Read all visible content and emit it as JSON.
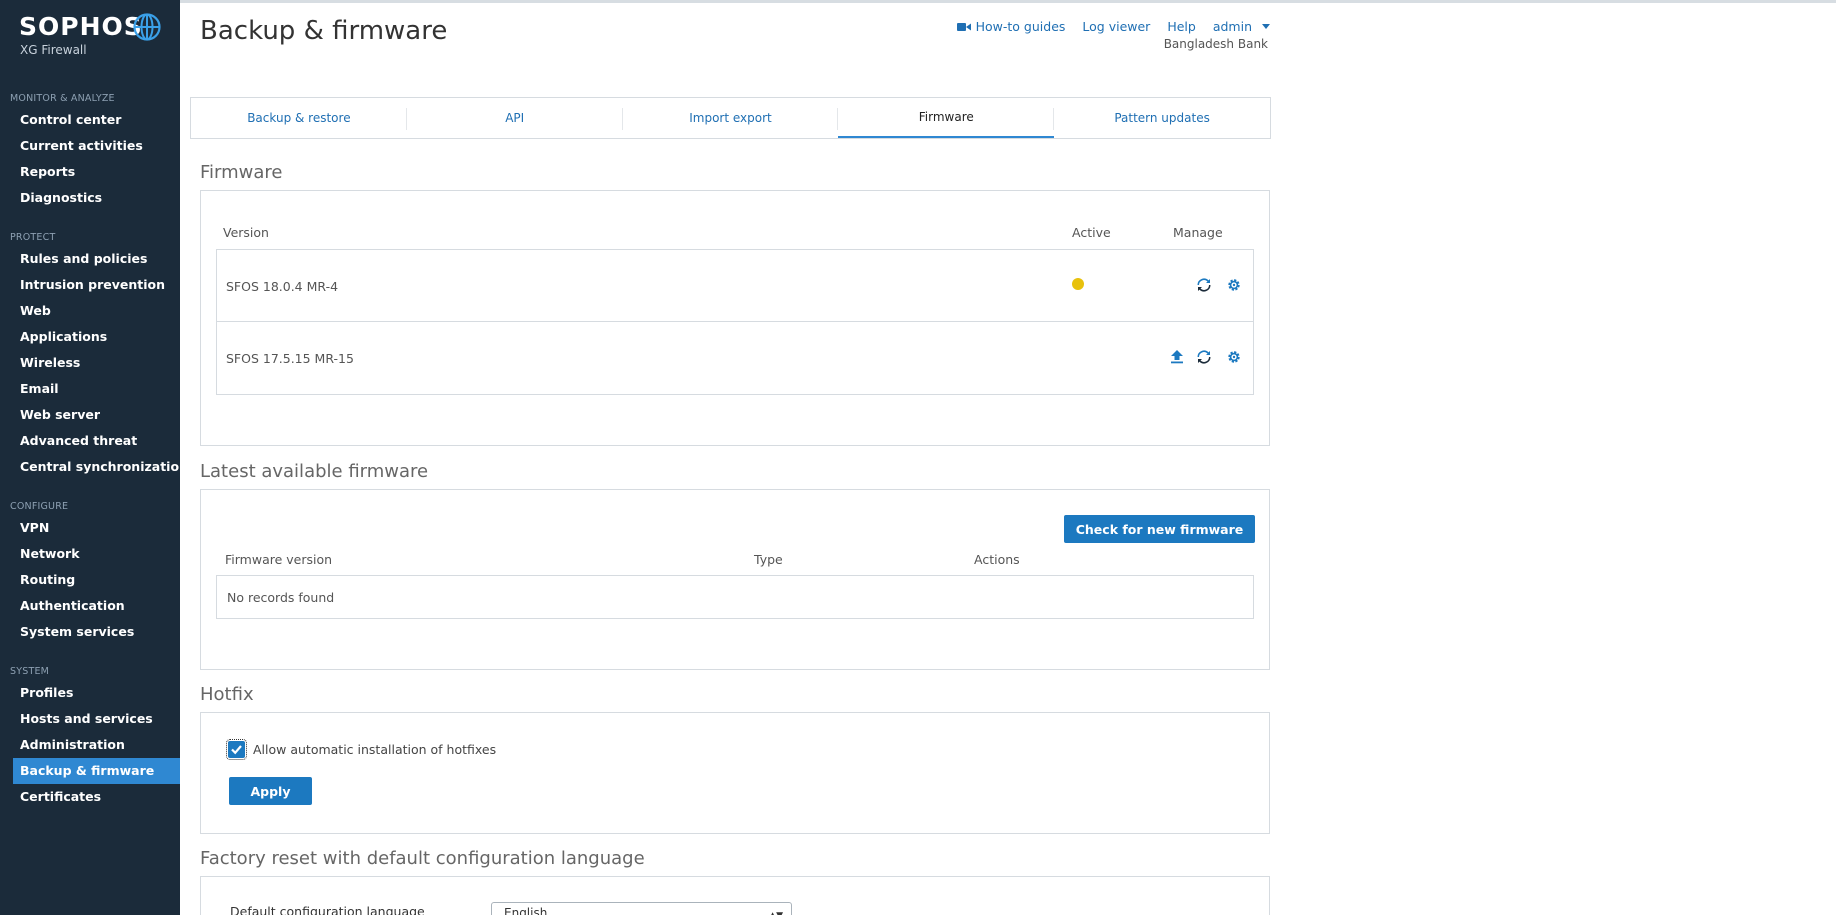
{
  "brand": {
    "name": "SOPHOS",
    "product": "XG Firewall",
    "accent": "#2f88d2",
    "sidebar_bg": "#1b2b3a"
  },
  "sidebar": {
    "sections": [
      {
        "heading": "MONITOR & ANALYZE",
        "items": [
          "Control center",
          "Current activities",
          "Reports",
          "Diagnostics"
        ]
      },
      {
        "heading": "PROTECT",
        "items": [
          "Rules and policies",
          "Intrusion prevention",
          "Web",
          "Applications",
          "Wireless",
          "Email",
          "Web server",
          "Advanced threat",
          "Central synchronization"
        ]
      },
      {
        "heading": "CONFIGURE",
        "items": [
          "VPN",
          "Network",
          "Routing",
          "Authentication",
          "System services"
        ]
      },
      {
        "heading": "SYSTEM",
        "items": [
          "Profiles",
          "Hosts and services",
          "Administration",
          "Backup & firmware",
          "Certificates"
        ]
      }
    ],
    "active_item": "Backup & firmware"
  },
  "header": {
    "title": "Backup & firmware",
    "links": {
      "howto": "How-to guides",
      "howto_icon": "video-camera-icon",
      "logviewer": "Log viewer",
      "help": "Help",
      "user": "admin"
    },
    "organization": "Bangladesh Bank"
  },
  "tabs": [
    {
      "label": "Backup & restore"
    },
    {
      "label": "API"
    },
    {
      "label": "Import export"
    },
    {
      "label": "Firmware"
    },
    {
      "label": "Pattern updates"
    }
  ],
  "active_tab": "Firmware",
  "firmware": {
    "section_title": "Firmware",
    "columns": {
      "version": "Version",
      "active": "Active",
      "manage": "Manage"
    },
    "rows": [
      {
        "version": "SFOS 18.0.4 MR-4",
        "active": true,
        "active_color": "#e8c10c",
        "manage_icons": [
          "refresh-icon",
          "gear-icon"
        ]
      },
      {
        "version": "SFOS 17.5.15 MR-15",
        "active": false,
        "manage_icons": [
          "upload-boot-icon",
          "refresh-icon",
          "gear-icon"
        ]
      }
    ]
  },
  "latest": {
    "section_title": "Latest available firmware",
    "check_button": "Check for new firmware",
    "columns": {
      "version": "Firmware version",
      "type": "Type",
      "actions": "Actions"
    },
    "empty_text": "No records found"
  },
  "hotfix": {
    "section_title": "Hotfix",
    "checkbox_label": "Allow automatic installation of hotfixes",
    "checked": true,
    "apply_button": "Apply"
  },
  "factory": {
    "section_title": "Factory reset with default configuration language",
    "language_label": "Default configuration language",
    "language_value": "English"
  }
}
